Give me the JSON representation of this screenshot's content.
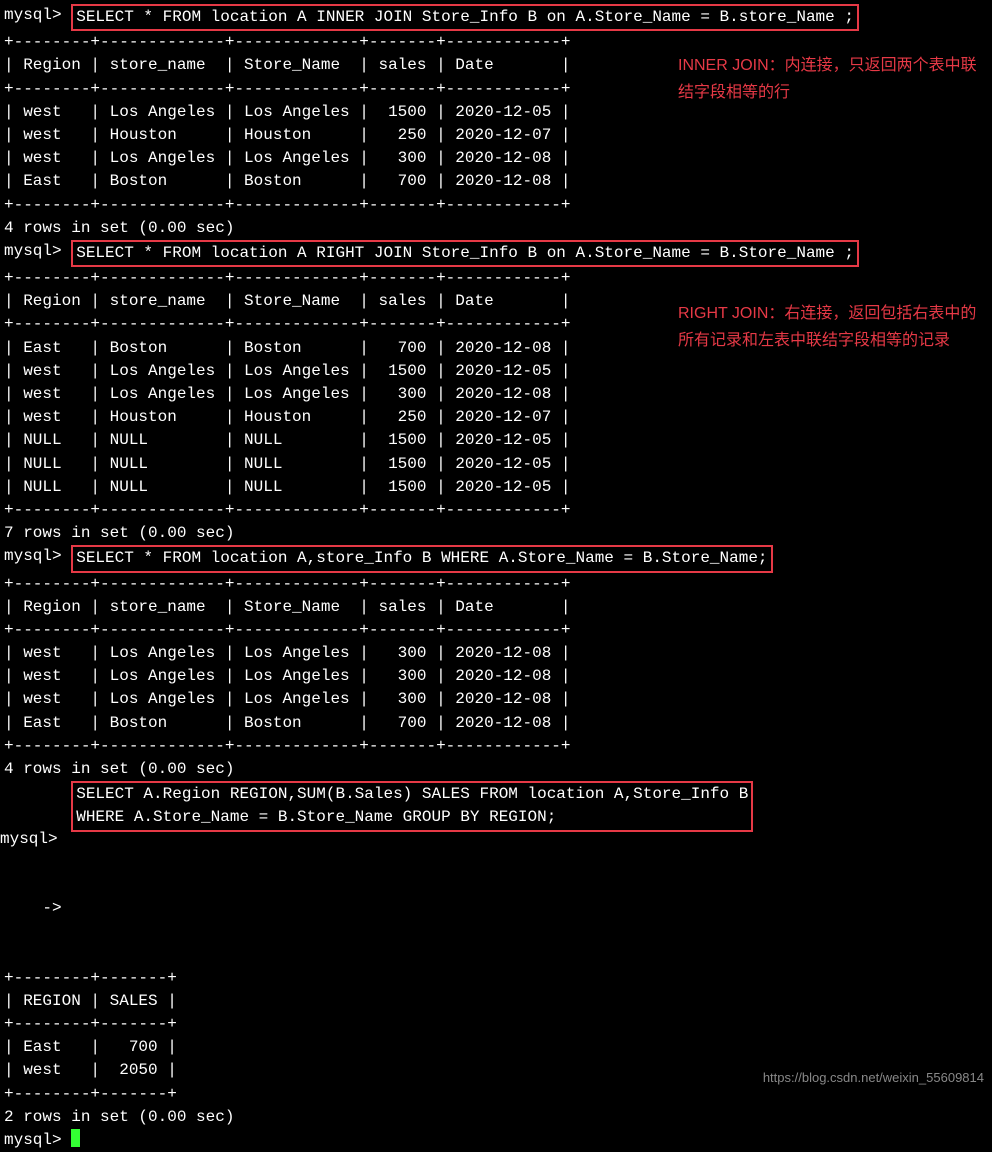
{
  "prompt": "mysql> ",
  "cont_prompt": "    -> ",
  "queries": {
    "q1": "SELECT * FROM location A INNER JOIN Store_Info B on A.Store_Name = B.store_Name ;",
    "q2": "SELECT * FROM location A RIGHT JOIN Store_Info B on A.Store_Name = B.Store_Name ;",
    "q3": "SELECT * FROM location A,store_Info B WHERE A.Store_Name = B.Store_Name;",
    "q4_l1": "SELECT A.Region REGION,SUM(B.Sales) SALES FROM location A,Store_Info B",
    "q4_l2": "WHERE A.Store_Name = B.Store_Name GROUP BY REGION;"
  },
  "tables": {
    "t1": {
      "border": "+--------+-------------+-------------+-------+------------+",
      "header": "| Region | store_name  | Store_Name  | sales | Date       |",
      "rows": [
        "| west   | Los Angeles | Los Angeles |  1500 | 2020-12-05 |",
        "| west   | Houston     | Houston     |   250 | 2020-12-07 |",
        "| west   | Los Angeles | Los Angeles |   300 | 2020-12-08 |",
        "| East   | Boston      | Boston      |   700 | 2020-12-08 |"
      ],
      "footer": "4 rows in set (0.00 sec)"
    },
    "t2": {
      "border": "+--------+-------------+-------------+-------+------------+",
      "header": "| Region | store_name  | Store_Name  | sales | Date       |",
      "rows": [
        "| East   | Boston      | Boston      |   700 | 2020-12-08 |",
        "| west   | Los Angeles | Los Angeles |  1500 | 2020-12-05 |",
        "| west   | Los Angeles | Los Angeles |   300 | 2020-12-08 |",
        "| west   | Houston     | Houston     |   250 | 2020-12-07 |",
        "| NULL   | NULL        | NULL        |  1500 | 2020-12-05 |",
        "| NULL   | NULL        | NULL        |  1500 | 2020-12-05 |",
        "| NULL   | NULL        | NULL        |  1500 | 2020-12-05 |"
      ],
      "footer": "7 rows in set (0.00 sec)"
    },
    "t3": {
      "border": "+--------+-------------+-------------+-------+------------+",
      "header": "| Region | store_name  | Store_Name  | sales | Date       |",
      "rows": [
        "| west   | Los Angeles | Los Angeles |   300 | 2020-12-08 |",
        "| west   | Los Angeles | Los Angeles |   300 | 2020-12-08 |",
        "| west   | Los Angeles | Los Angeles |   300 | 2020-12-08 |",
        "| East   | Boston      | Boston      |   700 | 2020-12-08 |"
      ],
      "footer": "4 rows in set (0.00 sec)"
    },
    "t4": {
      "border": "+--------+-------+",
      "header": "| REGION | SALES |",
      "rows": [
        "| East   |   700 |",
        "| west   |  2050 |"
      ],
      "footer": "2 rows in set (0.00 sec)"
    }
  },
  "annotations": {
    "a1": "INNER JOIN：内连接，只返回两个表中联结字段相等的行",
    "a2": "RIGHT JOIN：右连接，返回包括右表中的所有记录和左表中联结字段相等的记录"
  },
  "watermark": "https://blog.csdn.net/weixin_55609814",
  "blank": ""
}
